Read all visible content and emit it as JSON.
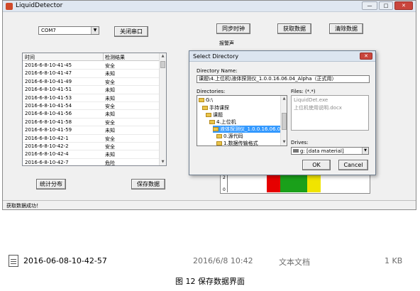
{
  "window": {
    "title": "LiquidDetector",
    "controls": [
      "—",
      "□",
      "✕"
    ]
  },
  "port": {
    "selected": "COM7",
    "close_button": "关闭串口"
  },
  "toolbar": {
    "sync_button": "同步时钟",
    "fetch_button": "获取数据",
    "clear_button": "清除数据"
  },
  "list": {
    "headers": [
      "时间",
      "检测结果"
    ],
    "rows": [
      {
        "time": "2016-6-8-10-41-45",
        "result": "安全"
      },
      {
        "time": "2016-6-8-10-41-47",
        "result": "未知"
      },
      {
        "time": "2016-6-8-10-41-49",
        "result": "安全"
      },
      {
        "time": "2016-6-8-10-41-51",
        "result": "未知"
      },
      {
        "time": "2016-6-8-10-41-53",
        "result": "未知"
      },
      {
        "time": "2016-6-8-10-41-54",
        "result": "安全"
      },
      {
        "time": "2016-6-8-10-41-56",
        "result": "未知"
      },
      {
        "time": "2016-6-8-10-41-58",
        "result": "安全"
      },
      {
        "time": "2016-6-8-10-41-59",
        "result": "未知"
      },
      {
        "time": "2016-6-8-10-42-1",
        "result": "安全"
      },
      {
        "time": "2016-6-8-10-42-2",
        "result": "安全"
      },
      {
        "time": "2016-6-8-10-42-4",
        "result": "未知"
      },
      {
        "time": "2016-6-8-10-42-7",
        "result": "危险"
      }
    ]
  },
  "bottom_buttons": {
    "stats_button": "统计分布",
    "save_button": "保存数据"
  },
  "report_group_label": "报警声",
  "chart_strip": {
    "axis_ticks": [
      "2",
      "0"
    ],
    "colors": [
      "#e60000",
      "#1aa01a",
      "#1aa01a",
      "#f0e400"
    ]
  },
  "status_text": "获取数据成功！",
  "dialog": {
    "title": "Select Directory",
    "close": "✕",
    "dir_name_label": "Directory Name:",
    "dir_name_value": "课题\\4.上位机\\液体探测仪_1.0.0.16.06.04_Alpha（正式用）",
    "directories_label": "Directories:",
    "tree": [
      {
        "label": "G:\\",
        "indent": 0
      },
      {
        "label": "手持课探",
        "indent": 1
      },
      {
        "label": "课题",
        "indent": 2
      },
      {
        "label": "4.上位机",
        "indent": 3
      },
      {
        "label": "液体探测仪_1.0.0.16.06.04_Al",
        "indent": 4,
        "selected": true
      },
      {
        "label": "0.源代码",
        "indent": 5
      },
      {
        "label": "1.数据传输格式",
        "indent": 5
      }
    ],
    "files_label": "Files: (*.*)",
    "files": [
      "LiquidDet.exe",
      "上位机使用说明.docx"
    ],
    "drives_label": "Drives:",
    "drive_value": "g: [data material]",
    "ok_button": "OK",
    "cancel_button": "Cancel"
  },
  "file_entry": {
    "name": "2016-06-08-10-42-57",
    "date": "2016/6/8 10:42",
    "type": "文本文档",
    "size": "1 KB"
  },
  "caption": "图 12 保存数据界面"
}
